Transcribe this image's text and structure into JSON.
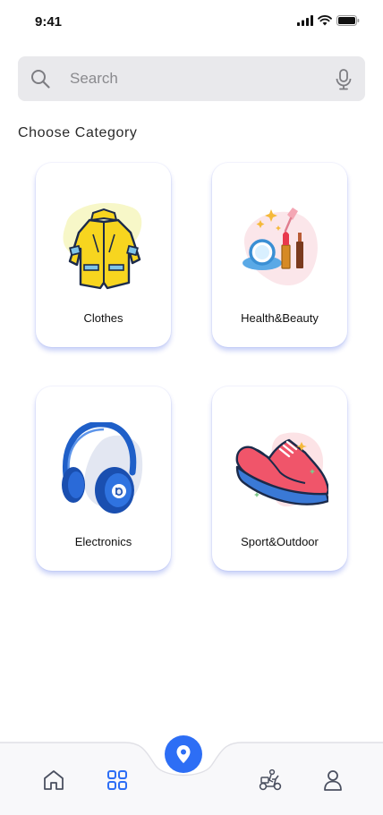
{
  "status_bar": {
    "time": "9:41",
    "icons": [
      "cellular-signal-icon",
      "wifi-icon",
      "battery-icon"
    ]
  },
  "search": {
    "placeholder": "Search",
    "value": "",
    "icons": [
      "search-icon",
      "microphone-icon"
    ]
  },
  "section_title": "Choose Category",
  "categories": [
    {
      "label": "Clothes",
      "icon": "jacket-icon",
      "blob_color": "#f7f7c8"
    },
    {
      "label": "Health&Beauty",
      "icon": "cosmetics-icon",
      "blob_color": "#fbe6ea"
    },
    {
      "label": "Electronics",
      "icon": "headphones-icon",
      "blob_color": "#e3e7f2"
    },
    {
      "label": "Sport&Outdoor",
      "icon": "sneaker-icon",
      "blob_color": "#fce3e6"
    }
  ],
  "bottom_nav": {
    "items": [
      "home-icon",
      "categories-grid-icon",
      "location-pin-icon",
      "delivery-scooter-icon",
      "profile-icon"
    ],
    "active_item": "categories-grid-icon",
    "accent_color": "#2d6ef5"
  }
}
